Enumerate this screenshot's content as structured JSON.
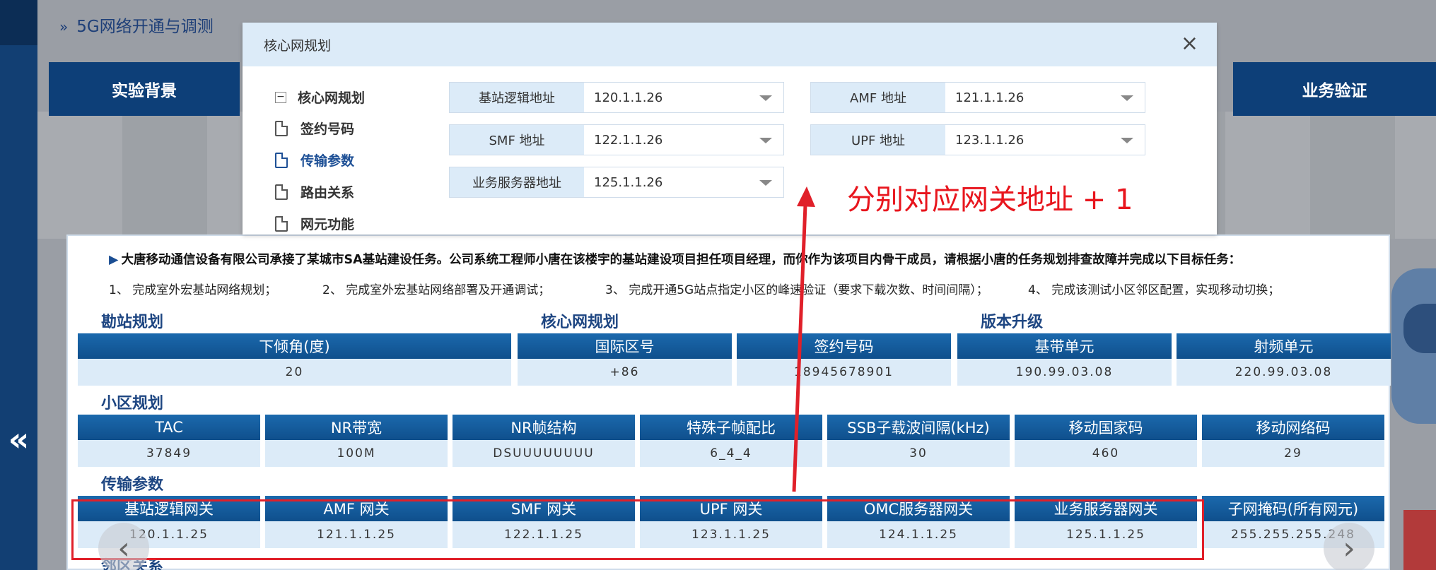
{
  "background": {
    "app_title": "5G网络开通与调测",
    "stage_first": "实验背景",
    "stage_last": "业务验证",
    "rail_arrow": "«"
  },
  "modal": {
    "title": "核心网规划",
    "close": "×",
    "tree": {
      "root": "核心网规划",
      "toggle": "−",
      "items": [
        "签约号码",
        "传输参数",
        "路由关系",
        "网元功能"
      ]
    },
    "fields": [
      {
        "label": "基站逻辑地址",
        "value": "120.1.1.26"
      },
      {
        "label": "AMF 地址",
        "value": "121.1.1.26"
      },
      {
        "label": "SMF 地址",
        "value": "122.1.1.26"
      },
      {
        "label": "UPF 地址",
        "value": "123.1.1.26"
      },
      {
        "label": "业务服务器地址",
        "value": "125.1.1.26"
      }
    ]
  },
  "task": {
    "intro": "大唐移动通信设备有限公司承接了某城市SA基站建设任务。公司系统工程师小唐在该楼宇的基站建设项目担任项目经理，而你作为该项目内骨干成员，请根据小唐的任务规划排查故障并完成以下目标任务：",
    "marker": "▶",
    "items": [
      "1、 完成室外宏基站网络规划；",
      "2、 完成室外宏基站网络部署及开通调试；",
      "3、 完成开通5G站点指定小区的峰速验证（要求下载次数、时间间隔）；",
      "4、 完成该测试小区邻区配置，实现移动切换；"
    ]
  },
  "sections": {
    "site": {
      "title": "勘站规划",
      "headers": [
        "下倾角(度)"
      ],
      "values": [
        "20"
      ]
    },
    "core": {
      "title": "核心网规划",
      "headers": [
        "国际区号",
        "签约号码"
      ],
      "values": [
        "+86",
        "18945678901"
      ]
    },
    "version": {
      "title": "版本升级",
      "headers": [
        "基带单元",
        "射频单元"
      ],
      "values": [
        "190.99.03.08",
        "220.99.03.08"
      ]
    },
    "cell": {
      "title": "小区规划",
      "headers": [
        "TAC",
        "NR带宽",
        "NR帧结构",
        "特殊子帧配比",
        "SSB子载波间隔(kHz)",
        "移动国家码",
        "移动网络码"
      ],
      "values": [
        "37849",
        "100M",
        "DSUUUUUUUU",
        "6_4_4",
        "30",
        "460",
        "29"
      ]
    },
    "transport": {
      "title": "传输参数",
      "headers": [
        "基站逻辑网关",
        "AMF 网关",
        "SMF 网关",
        "UPF 网关",
        "OMC服务器网关",
        "业务服务器网关",
        "子网掩码(所有网元)"
      ],
      "values": [
        "120.1.1.25",
        "121.1.1.25",
        "122.1.1.25",
        "123.1.1.25",
        "124.1.1.25",
        "125.1.1.25",
        "255.255.255.248"
      ]
    },
    "neighbor": {
      "title": "邻区关系"
    }
  },
  "annotation": {
    "text": "分别对应网关地址 + 1",
    "color": "#e8151d"
  },
  "nav": {
    "prev": "‹",
    "next": "›"
  },
  "colors": {
    "header_blue": "#0f4f8c",
    "cell_light": "#dcebf8",
    "title_blue": "#1e4682",
    "rail": "#123f73"
  }
}
